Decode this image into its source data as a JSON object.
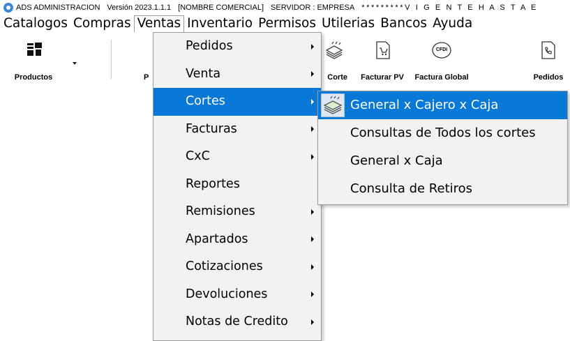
{
  "title": {
    "app_name": "ADS ADMINISTRACION",
    "version": "Versión 2023.1.1.1",
    "comercial": "[NOMBRE COMERCIAL]",
    "servidor": "SERVIDOR : EMPRESA",
    "vigencia": "*********V I G E N T E  H A S T A  E"
  },
  "menubar": [
    "Catalogos",
    "Compras",
    "Ventas",
    "Inventario",
    "Permisos",
    "Utilerias",
    "Bancos",
    "Ayuda"
  ],
  "toolbar": {
    "productos": "Productos",
    "p_partial": "P",
    "corte_partial": "Corte",
    "facturar_pv": "Facturar PV",
    "factura_global": "Factura Global",
    "pedidos": "Pedidos",
    "cfdi_badge": "CFDI"
  },
  "ventas_menu": [
    "Pedidos",
    "Venta",
    "Cortes",
    "Facturas",
    "CxC",
    "Reportes",
    "Remisiones",
    "Apartados",
    "Cotizaciones",
    "Devoluciones",
    "Notas de Credito"
  ],
  "cortes_submenu": [
    "General x Cajero x Caja",
    "Consultas de Todos los cortes",
    "General x Caja",
    "Consulta de Retiros"
  ],
  "colors": {
    "highlight": "#0a78d7"
  },
  "icons": {
    "productos": "box-hand-icon",
    "corte": "money-stack-icon",
    "facturar_pv": "cart-document-icon",
    "factura_global": "cfdi-badge-icon",
    "pedidos": "phone-document-icon"
  }
}
